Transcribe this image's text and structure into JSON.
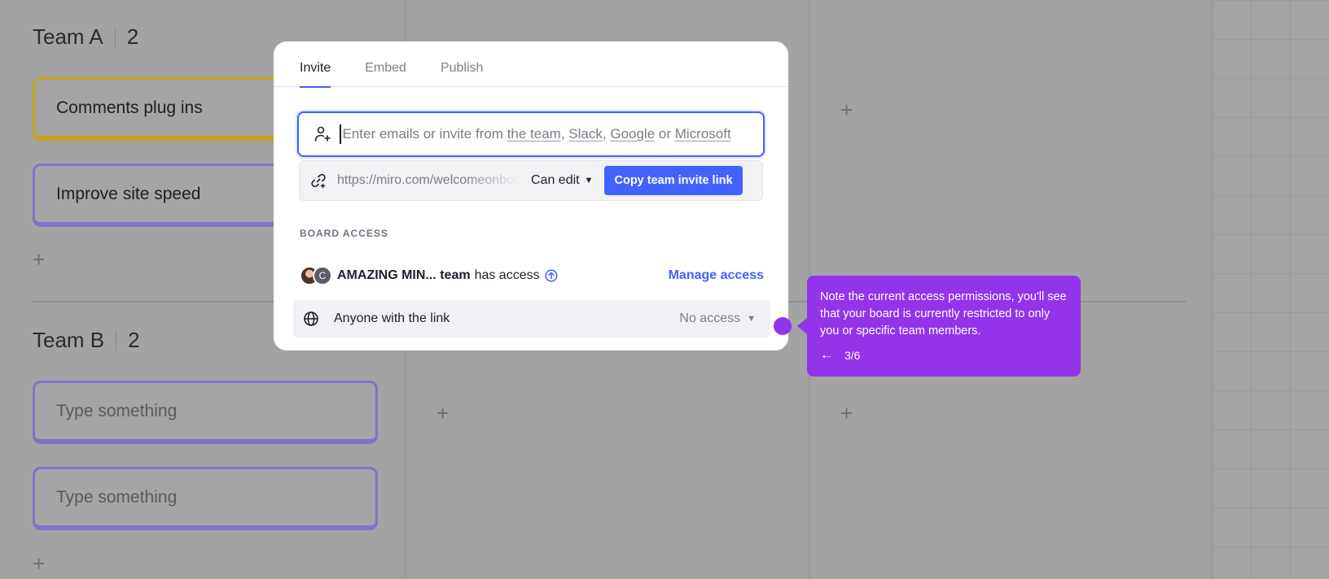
{
  "board": {
    "team_a": {
      "name": "Team A",
      "count": "2"
    },
    "team_b": {
      "name": "Team B",
      "count": "2"
    },
    "cards_a": [
      "Comments plug ins",
      "Improve site speed"
    ],
    "cards_b": [
      "Type something",
      "Type something"
    ],
    "add_symbol": "+"
  },
  "modal": {
    "tabs": [
      {
        "label": "Invite",
        "active": true
      },
      {
        "label": "Embed",
        "active": false
      },
      {
        "label": "Publish",
        "active": false
      }
    ],
    "invite": {
      "prefix": "Enter emails or invite from ",
      "the_team": "the team",
      "sep1": ", ",
      "slack": "Slack",
      "sep2": ", ",
      "google": "Google",
      "or": " or ",
      "microsoft": "Microsoft"
    },
    "link": {
      "url": "https://miro.com/welcomeonboard",
      "permission": "Can edit",
      "copy_label": "Copy team invite link"
    },
    "board_access_label": "BOARD ACCESS",
    "team_access": {
      "avatar_letter": "C",
      "team_name": "AMAZING MIN... team",
      "has_access": "has access",
      "manage_label": "Manage access"
    },
    "link_access": {
      "label": "Anyone with the link",
      "value": "No access"
    }
  },
  "guide": {
    "text": "Note the current access permissions, you'll see that your board is currently restricted to only you or specific team members.",
    "step": "3/6",
    "back_symbol": "←"
  },
  "colors": {
    "accent": "#4262ff",
    "guide": "#9333ea"
  }
}
